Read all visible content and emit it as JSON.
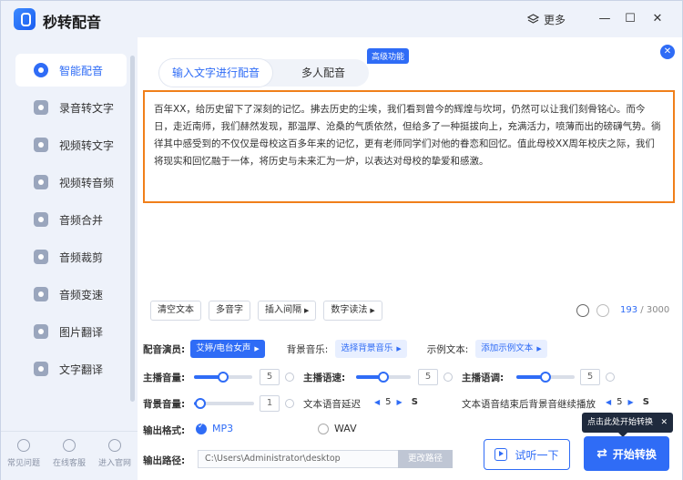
{
  "app": {
    "title": "秒转配音"
  },
  "titlebar": {
    "more_label": "更多",
    "minimize": "—",
    "maximize": "☐",
    "close": "✕"
  },
  "sidebar": {
    "items": [
      {
        "label": "智能配音",
        "icon": "mic-icon",
        "active": true
      },
      {
        "label": "录音转文字",
        "icon": "transcribe-icon"
      },
      {
        "label": "视频转文字",
        "icon": "video-text-icon"
      },
      {
        "label": "视频转音频",
        "icon": "video-audio-icon"
      },
      {
        "label": "音频合并",
        "icon": "merge-icon"
      },
      {
        "label": "音频裁剪",
        "icon": "cut-icon"
      },
      {
        "label": "音频变速",
        "icon": "speed-icon"
      },
      {
        "label": "图片翻译",
        "icon": "image-translate-icon"
      },
      {
        "label": "文字翻译",
        "icon": "text-translate-icon"
      }
    ],
    "footer": [
      {
        "label": "常见问题",
        "icon": "help-icon"
      },
      {
        "label": "在线客服",
        "icon": "chat-icon"
      },
      {
        "label": "进入官网",
        "icon": "home-icon"
      }
    ]
  },
  "tabs": {
    "text_tab": "输入文字进行配音",
    "multi_tab": "多人配音",
    "pro_badge": "高级功能"
  },
  "editor": {
    "content": "百年XX，给历史留下了深刻的记忆。拂去历史的尘埃，我们看到曾今的辉煌与坎坷，仍然可以让我们刻骨铭心。而今日，走近南师，我们赫然发现，那温厚、沧桑的气质依然，但给多了一种挺拔向上，充满活力，喷薄而出的磅礴气势。徜徉其中感受到的不仅仅是母校这百多年来的记忆，更有老师同学们对他的眷恋和回忆。值此母校XX周年校庆之际，我们将现实和回忆融于一体，将历史与未来汇为一炉，以表达对母校的挚爱和感激。",
    "tools": {
      "clear": "清空文本",
      "polyphone": "多音字",
      "insert_pause": "插入间隔",
      "number_read": "数字读法"
    },
    "counter": {
      "current": "193",
      "max": "/ 3000"
    }
  },
  "settings": {
    "voice_label": "配音演员:",
    "voice_value": "艾婷/电台女声",
    "bgm_label": "背景音乐:",
    "bgm_value": "选择背景音乐",
    "sample_label": "示例文本:",
    "sample_value": "添加示例文本",
    "host_volume_label": "主播音量:",
    "host_volume": {
      "value": "5",
      "fraction": 0.5
    },
    "host_speed_label": "主播语速:",
    "host_speed": {
      "value": "5",
      "fraction": 0.5
    },
    "host_pitch_label": "主播语调:",
    "host_pitch": {
      "value": "5",
      "fraction": 0.5
    },
    "bg_volume_label": "背景音量:",
    "bg_volume": {
      "value": "1",
      "fraction": 0.1
    },
    "delay_label": "文本语音延迟",
    "delay_value": "5",
    "delay_unit": "S",
    "continue_label": "文本语音结束后背景音继续播放",
    "continue_value": "5",
    "continue_unit": "S",
    "format_label": "输出格式:",
    "format_mp3": "MP3",
    "format_wav": "WAV",
    "path_label": "输出路径:",
    "path_value": "C:\\Users\\Administrator\\desktop",
    "change_path": "更改路径"
  },
  "actions": {
    "preview": "试听一下",
    "start": "开始转换",
    "tooltip": "点击此处开始转换"
  },
  "colors": {
    "accent": "#2f6cf6",
    "highlight_border": "#f07f1a"
  }
}
